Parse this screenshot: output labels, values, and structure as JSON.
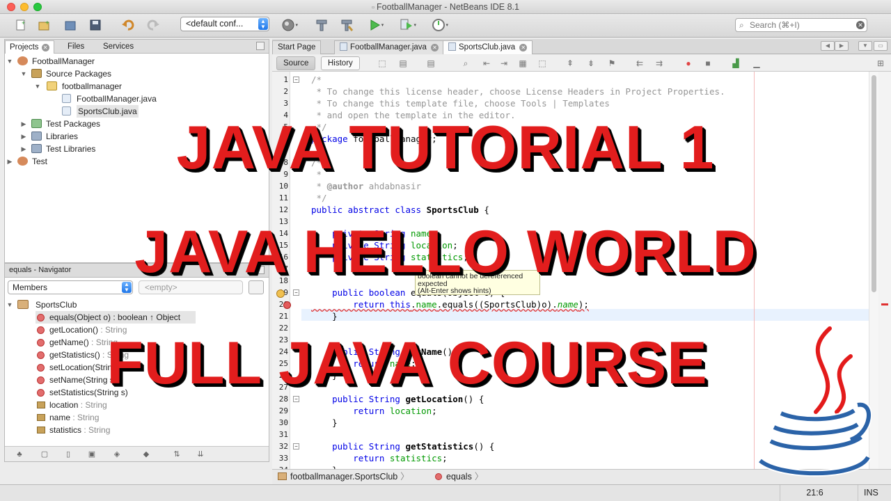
{
  "window": {
    "title": "FootballManager - NetBeans IDE 8.1"
  },
  "colors": {
    "overlay_red": "#e21d1d",
    "accent_blue": "#1f76e8",
    "comment_gray": "#969696",
    "keyword_blue": "#0000e6",
    "field_green": "#009900"
  },
  "toolbar": {
    "config_value": "<default conf...",
    "search_placeholder": "Search (⌘+I)",
    "icons": [
      "new-file-icon",
      "new-project-icon",
      "open-project-icon",
      "save-all-icon",
      "undo-icon",
      "redo-icon",
      "globe-icon",
      "build-icon",
      "clean-build-icon",
      "run-icon",
      "debug-icon",
      "profile-icon"
    ]
  },
  "projects_panel": {
    "tabs": [
      "Projects",
      "Files",
      "Services"
    ],
    "tree": [
      {
        "label": "FootballManager"
      },
      {
        "label": "Source Packages"
      },
      {
        "label": "footballmanager"
      },
      {
        "label": "FootballManager.java"
      },
      {
        "label": "SportsClub.java"
      },
      {
        "label": "Test Packages"
      },
      {
        "label": "Libraries"
      },
      {
        "label": "Test Libraries"
      },
      {
        "label": "Test"
      }
    ]
  },
  "navigator": {
    "title": "equals - Navigator",
    "filter_value": "Members",
    "empty_value": "<empty>",
    "root": "SportsClub",
    "members": [
      {
        "name": "equals(Object o)",
        "type": " : boolean ↑ Object"
      },
      {
        "name": "getLocation()",
        "type": " : String"
      },
      {
        "name": "getName()",
        "type": " : String"
      },
      {
        "name": "getStatistics()",
        "type": " : String"
      },
      {
        "name": "setLocation(String l)",
        "type": ""
      },
      {
        "name": "setName(String s)",
        "type": ""
      },
      {
        "name": "setStatistics(String s)",
        "type": ""
      },
      {
        "name": "location",
        "type": " : String"
      },
      {
        "name": "name",
        "type": " : String"
      },
      {
        "name": "statistics",
        "type": " : String"
      }
    ]
  },
  "editor": {
    "tabs": [
      "Start Page",
      "FootballManager.java",
      "SportsClub.java"
    ],
    "view_buttons": [
      "Source",
      "History"
    ],
    "line_numbers": [
      "1",
      "2",
      "3",
      "4",
      "5",
      "6",
      "7",
      "8",
      "9",
      "10",
      "11",
      "12",
      "13",
      "14",
      "15",
      "16",
      "17",
      "18",
      "19",
      "20",
      "21",
      "22",
      "23",
      "24",
      "25",
      "26",
      "27",
      "28",
      "29",
      "30",
      "31",
      "32",
      "33",
      "34"
    ],
    "code": {
      "l1": "/*",
      "l2": " * To change this license header, choose License Headers in Project Properties.",
      "l3": " * To change this template file, choose Tools | Templates",
      "l4": " * and open the template in the editor.",
      "l5": " */",
      "l6_kw": "package ",
      "l6_rest": "footballmanager;",
      "l8": "/**",
      "l9": " *",
      "l10_a": " * ",
      "l10_b": "@author",
      "l10_c": " ahdabnasir",
      "l11": " */",
      "l12_kw": "public abstract class ",
      "l12_name": "SportsClub",
      "l12_end": " {",
      "l14_kw": "    private String ",
      "l14_f": "name",
      "l14_e": ";",
      "l15_kw": "    private String ",
      "l15_f": "location",
      "l15_e": ";",
      "l16_kw": "    private String ",
      "l16_f": "statistics",
      "l16_e": ";",
      "l19_kw": "    public boolean ",
      "l19_rest": "equals(Object o) {",
      "l20_kw": "        return this",
      "l20_a": ".",
      "l20_f": "name",
      "l20_b": ".equals((SportsClub)o).",
      "l20_f2": "name",
      "l20_c": ");",
      "l21": "    }",
      "l23_kw": "    public String ",
      "l23_m": "getName",
      "l23_e": "() {",
      "l24_kw": "        return ",
      "l24_f": "name",
      "l24_e": ";",
      "l25": "    }",
      "l28_kw": "    public String ",
      "l28_m": "getLocation",
      "l28_e": "() {",
      "l29_kw": "        return ",
      "l29_f": "location",
      "l29_e": ";",
      "l30": "    }",
      "l32_kw": "    public String ",
      "l32_m": "getStatistics",
      "l32_e": "() {",
      "l33_kw": "        return ",
      "l33_f": "statistics",
      "l33_e": ";",
      "l34": "    }"
    },
    "hint": {
      "line1": "boolean cannot be dereferenced",
      "line2": "expected",
      "line3": "(Alt-Enter shows hints)"
    }
  },
  "breadcrumbs": [
    "footballmanager.SportsClub",
    "equals"
  ],
  "status": {
    "position": "21:6",
    "mode": "INS"
  },
  "overlay": {
    "line1": "JAVA TUTORIAL 1",
    "line2": "JAVA HELLO WORLD",
    "line3": "FULL JAVA COURSE"
  }
}
